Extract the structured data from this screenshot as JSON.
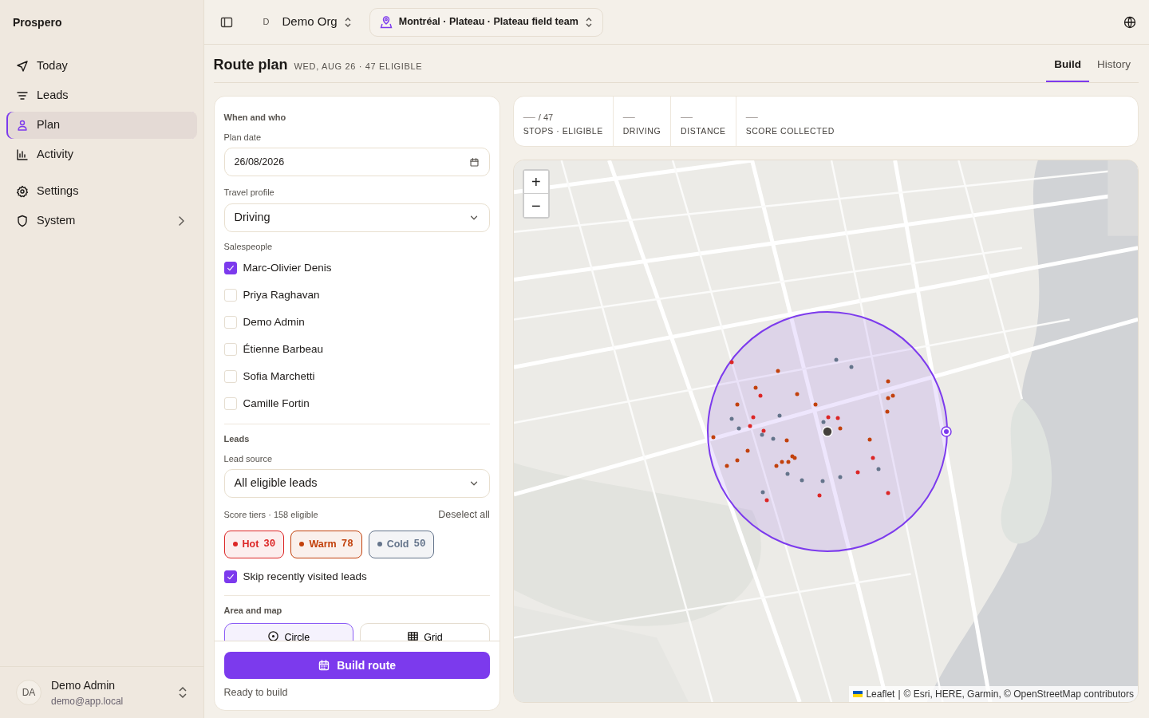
{
  "app": {
    "name": "Prospero"
  },
  "nav": [
    {
      "label": "Today",
      "selected": false
    },
    {
      "label": "Leads",
      "selected": false
    },
    {
      "label": "Plan",
      "selected": true
    },
    {
      "label": "Activity",
      "selected": false
    },
    {
      "label": "Settings",
      "selected": false
    },
    {
      "label": "System",
      "selected": false,
      "expandable": true
    }
  ],
  "user": {
    "initials": "DA",
    "name": "Demo Admin",
    "email": "demo@app.local"
  },
  "topbar": {
    "org_initial": "D",
    "org": "Demo Org",
    "location": "Montréal · Plateau · Plateau field team"
  },
  "page": {
    "title": "Route plan",
    "subtitle": "WED, AUG 26 · 47 ELIGIBLE"
  },
  "tabs": [
    {
      "label": "Build",
      "selected": true
    },
    {
      "label": "History",
      "selected": false
    }
  ],
  "form": {
    "section1": "When and who",
    "plan_date": {
      "label": "Plan date",
      "value": "26/08/2026"
    },
    "travel": {
      "label": "Travel profile",
      "value": "Driving"
    },
    "salespeople_label": "Salespeople",
    "salespeople": [
      {
        "name": "Marc-Olivier Denis",
        "checked": true
      },
      {
        "name": "Priya Raghavan",
        "checked": false
      },
      {
        "name": "Demo Admin",
        "checked": false
      },
      {
        "name": "Étienne Barbeau",
        "checked": false
      },
      {
        "name": "Sofia Marchetti",
        "checked": false
      },
      {
        "name": "Camille Fortin",
        "checked": false
      }
    ],
    "section2": "Leads",
    "lead_source": {
      "label": "Lead source",
      "value": "All eligible leads"
    },
    "tiers_label": "Score tiers · 158 eligible",
    "deselect": "Deselect all",
    "tiers": [
      {
        "label": "Hot",
        "count": "30",
        "color": "#dc2626",
        "selected": true
      },
      {
        "label": "Warm",
        "count": "78",
        "color": "#c2410c",
        "selected": true
      },
      {
        "label": "Cold",
        "count": "50",
        "color": "#64748b",
        "selected": true
      }
    ],
    "skip": {
      "label": "Skip recently visited leads",
      "checked": true
    },
    "section3": "Area and map",
    "area_modes": [
      {
        "label": "Circle",
        "selected": true
      },
      {
        "label": "Grid",
        "selected": false
      }
    ],
    "build_button": "Build route",
    "status": "Ready to build"
  },
  "stats": [
    {
      "value": "—",
      "suffix": "/ 47",
      "label": "STOPS · ELIGIBLE"
    },
    {
      "value": "—",
      "label": "DRIVING"
    },
    {
      "value": "—",
      "label": "DISTANCE"
    },
    {
      "value": "—",
      "label": "SCORE COLLECTED"
    }
  ],
  "map": {
    "zoom_in": "+",
    "zoom_out": "−",
    "attribution": [
      {
        "kind": "link",
        "text": "Leaflet"
      },
      {
        "kind": "sep",
        "text": "|"
      },
      {
        "kind": "text",
        "text": "© "
      },
      {
        "kind": "link",
        "text": "Esri"
      },
      {
        "kind": "text",
        "text": ", HERE, Garmin, © "
      },
      {
        "kind": "link",
        "text": "OpenStreetMap"
      },
      {
        "kind": "text",
        "text": " contributors"
      }
    ]
  }
}
